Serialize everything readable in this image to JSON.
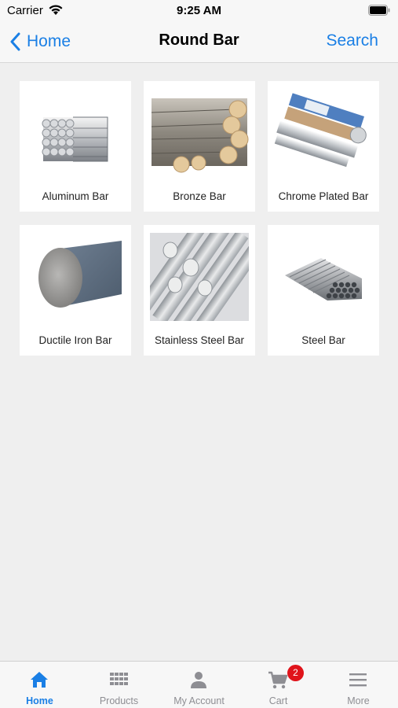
{
  "status": {
    "carrier": "Carrier",
    "time": "9:25 AM"
  },
  "nav": {
    "back_label": "Home",
    "title": "Round Bar",
    "search_label": "Search"
  },
  "products": [
    {
      "label": "Aluminum Bar",
      "icon": "aluminum-bar-image"
    },
    {
      "label": "Bronze Bar",
      "icon": "bronze-bar-image"
    },
    {
      "label": "Chrome Plated Bar",
      "icon": "chrome-plated-bar-image"
    },
    {
      "label": "Ductile Iron Bar",
      "icon": "ductile-iron-bar-image"
    },
    {
      "label": "Stainless Steel Bar",
      "icon": "stainless-steel-bar-image"
    },
    {
      "label": "Steel Bar",
      "icon": "steel-bar-image"
    }
  ],
  "tabs": [
    {
      "label": "Home",
      "icon": "home-icon",
      "active": true
    },
    {
      "label": "Products",
      "icon": "grid-icon"
    },
    {
      "label": "My Account",
      "icon": "person-icon"
    },
    {
      "label": "Cart",
      "icon": "cart-icon",
      "badge": "2"
    },
    {
      "label": "More",
      "icon": "menu-icon"
    }
  ],
  "colors": {
    "accent": "#1a7fe5",
    "badge": "#e0141b",
    "background": "#efefef"
  }
}
